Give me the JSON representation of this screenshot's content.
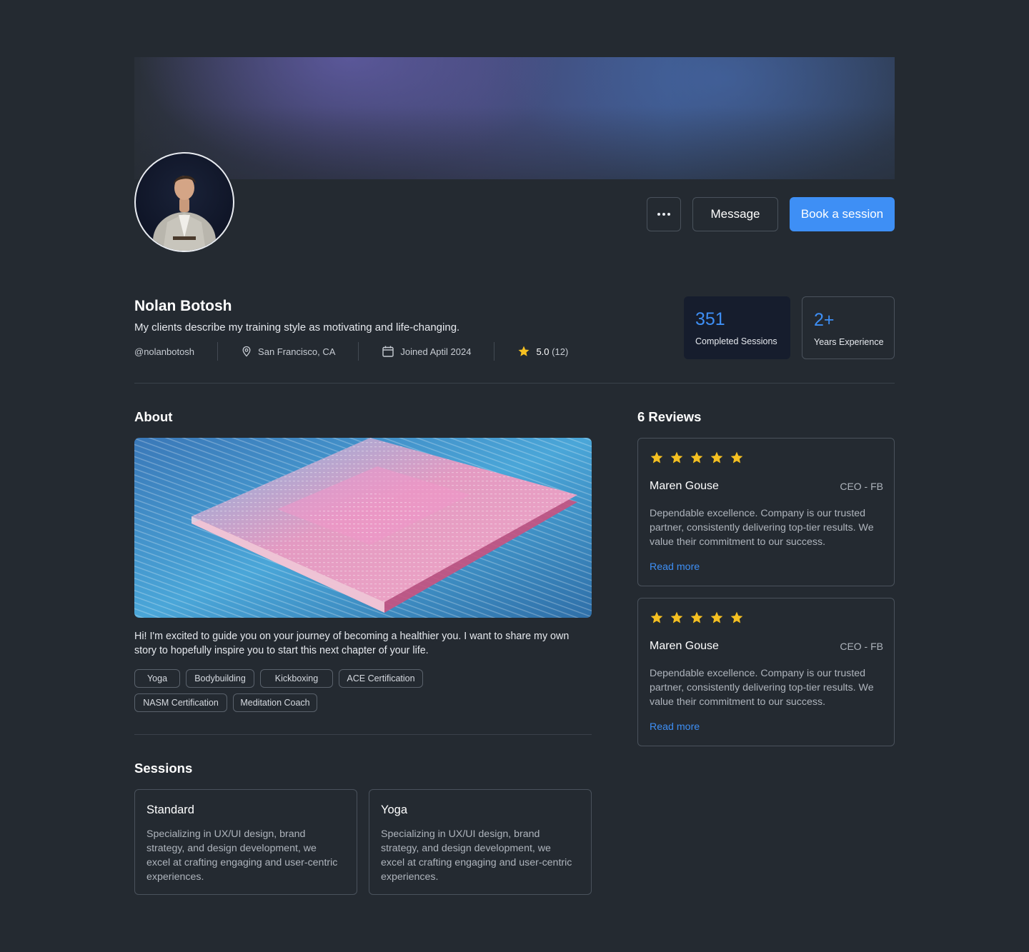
{
  "header": {
    "more_label": "...",
    "message_label": "Message",
    "book_label": "Book a session"
  },
  "profile": {
    "name": "Nolan Botosh",
    "bio": "My clients describe my training style as motivating and life-changing.",
    "handle": "@nolanbotosh",
    "location": "San Francisco, CA",
    "joined": "Joined Aptil 2024",
    "rating": "5.0",
    "rating_count": "(12)"
  },
  "stats": [
    {
      "value": "351",
      "label": "Completed Sessions"
    },
    {
      "value": "2+",
      "label": "Years Experience"
    }
  ],
  "about": {
    "title": "About",
    "text": "Hi! I'm excited to guide you on your journey of becoming a healthier you. I want to share my own story to hopefully inspire you to start this next chapter of your life.",
    "tags": [
      "Yoga",
      "Bodybuilding",
      "Kickboxing",
      "ACE Certification",
      "NASM Certification",
      "Meditation Coach"
    ]
  },
  "sessions": {
    "title": "Sessions",
    "items": [
      {
        "title": "Standard",
        "desc": "Specializing in UX/UI design, brand strategy, and design development, we excel at crafting engaging and user-centric experiences."
      },
      {
        "title": "Yoga",
        "desc": "Specializing in UX/UI design, brand strategy, and design development, we excel at crafting engaging and user-centric experiences."
      }
    ]
  },
  "reviews": {
    "title": "6 Reviews",
    "items": [
      {
        "stars": 5,
        "name": "Maren Gouse",
        "role": "CEO - FB",
        "text": "Dependable excellence. Company is our trusted partner, consistently delivering top-tier results. We value their commitment to our success.",
        "link": "Read more"
      },
      {
        "stars": 5,
        "name": "Maren Gouse",
        "role": "CEO - FB",
        "text": "Dependable excellence. Company is our trusted partner, consistently delivering top-tier results. We value their commitment to our success.",
        "link": "Read more"
      }
    ]
  },
  "colors": {
    "background": "#242a31",
    "accent": "#3e8ff5",
    "star": "#f5c021",
    "border": "#4a525c"
  }
}
